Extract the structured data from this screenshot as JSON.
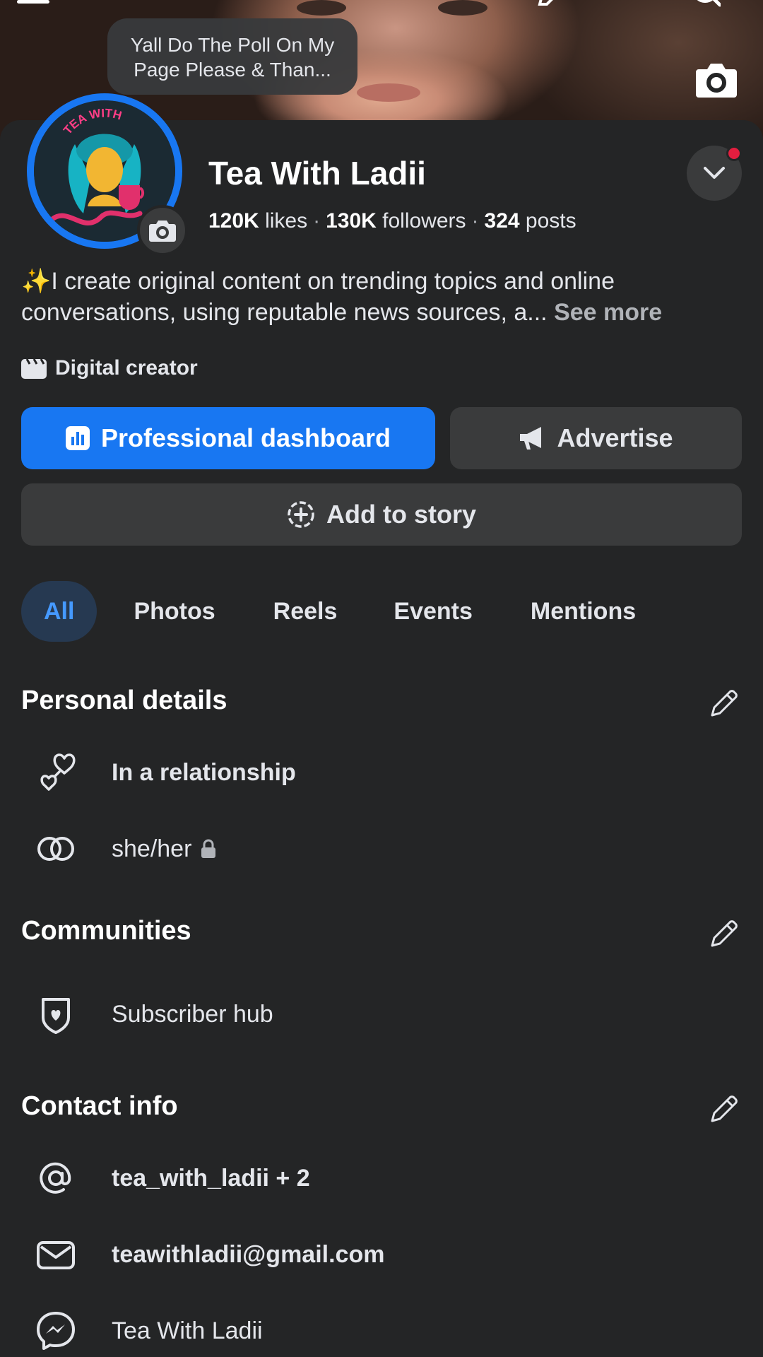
{
  "cover": {
    "note": "Yall Do The Poll On My Page Please & Than..."
  },
  "profile": {
    "name": "Tea With Ladii",
    "stats": {
      "likes_value": "120K",
      "likes_label": "likes",
      "followers_value": "130K",
      "followers_label": "followers",
      "posts_value": "324",
      "posts_label": "posts",
      "separator": "·"
    },
    "bio_emoji": "✨",
    "bio": "I create original content on trending topics and online conversations, using reputable news sources, a...",
    "see_more": "See more",
    "category": "Digital creator"
  },
  "actions": {
    "dashboard": "Professional dashboard",
    "advertise": "Advertise",
    "add_story": "Add to story"
  },
  "tabs": [
    {
      "label": "All",
      "active": true
    },
    {
      "label": "Photos"
    },
    {
      "label": "Reels"
    },
    {
      "label": "Events"
    },
    {
      "label": "Mentions"
    }
  ],
  "personal_details": {
    "title": "Personal details",
    "relationship": "In a relationship",
    "pronouns": "she/her"
  },
  "communities": {
    "title": "Communities",
    "subscriber_hub": "Subscriber hub"
  },
  "contact_info": {
    "title": "Contact info",
    "instagram": "tea_with_ladii + 2",
    "email": "teawithladii@gmail.com",
    "messenger": "Tea With Ladii"
  },
  "colors": {
    "background": "#242526",
    "accent": "#1877f2",
    "button_secondary": "#3a3b3c",
    "active_tab_bg": "#263951",
    "active_tab_text": "#4599ff",
    "notification": "#e41e3f"
  }
}
